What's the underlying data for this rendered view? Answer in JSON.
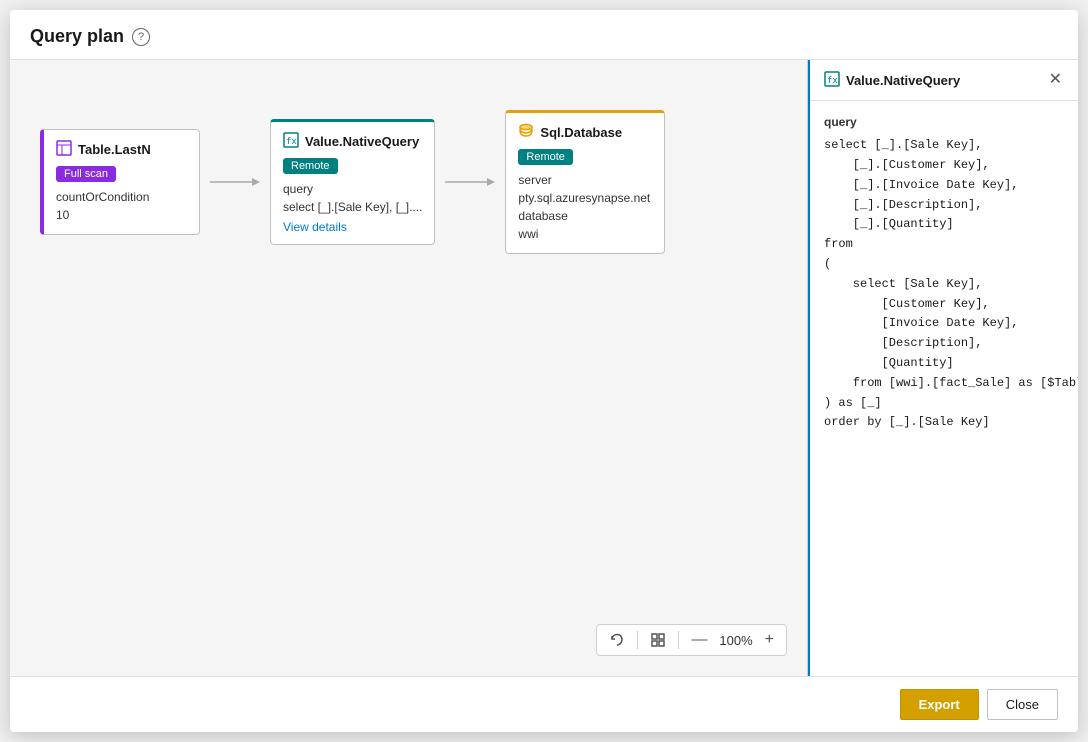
{
  "dialog": {
    "title": "Query plan",
    "help_icon_label": "?"
  },
  "nodes": [
    {
      "id": "table-lastn",
      "title": "Table.LastN",
      "badge": "Full scan",
      "badge_type": "fullscan",
      "props": [
        "countOrCondition",
        "10"
      ],
      "icon_type": "table"
    },
    {
      "id": "value-native-query",
      "title": "Value.NativeQuery",
      "badge": "Remote",
      "badge_type": "remote",
      "props_label": "query",
      "props_value": "select [_].[Sale Key], [_]....",
      "link_label": "View details",
      "icon_type": "value"
    },
    {
      "id": "sql-database",
      "title": "Sql.Database",
      "badge": "Remote",
      "badge_type": "remote",
      "server_label": "server",
      "server_value": "pty.sql.azuresynapse.net",
      "database_label": "database",
      "database_value": "wwi",
      "icon_type": "sql"
    }
  ],
  "zoom": {
    "level": "100%"
  },
  "detail_panel": {
    "title": "Value.NativeQuery",
    "section_label": "query",
    "code": "select [_].[Sale Key],\n    [_].[Customer Key],\n    [_].[Invoice Date Key],\n    [_].[Description],\n    [_].[Quantity]\nfrom\n(\n    select [Sale Key],\n        [Customer Key],\n        [Invoice Date Key],\n        [Description],\n        [Quantity]\n    from [wwi].[fact_Sale] as [$Table]\n) as [_]\norder by [_].[Sale Key]"
  },
  "footer": {
    "export_label": "Export",
    "close_label": "Close"
  }
}
